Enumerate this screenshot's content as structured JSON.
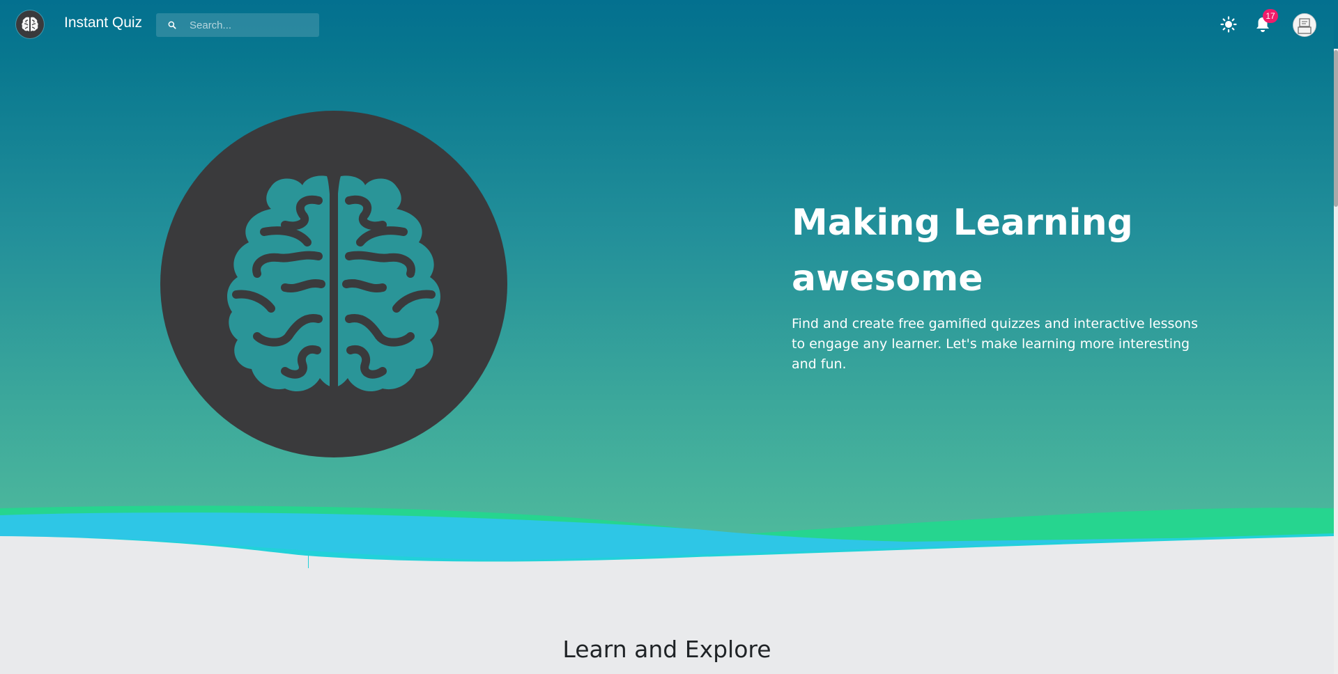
{
  "app": {
    "title": "Instant Quiz",
    "logo_icon": "brain-icon"
  },
  "search": {
    "placeholder": "Search...",
    "value": "",
    "icon": "search-icon"
  },
  "header_actions": {
    "theme_icon": "sun-icon",
    "notifications_icon": "bell-icon",
    "notification_count": "17",
    "avatar_icon": "user-avatar"
  },
  "hero": {
    "title_line1": "Making Learning",
    "title_line2": "awesome",
    "subtitle": "Find and create free gamified quizzes and interactive lessons to engage any learner. Let's make learning more interesting and fun.",
    "graphic_icon": "brain-icon"
  },
  "sections": {
    "learn_title": "Learn and Explore"
  },
  "colors": {
    "header_top": "#03708f",
    "hero_bottom": "#52bc9c",
    "brain_circle": "#3a3a3c",
    "brain_fill": "#2a9598",
    "wave_green": "#26d58f",
    "wave_blue": "#2ec6e6",
    "wave_cyan": "#22d1d9",
    "badge": "#f01c6a",
    "page_background": "#e9eaec"
  }
}
